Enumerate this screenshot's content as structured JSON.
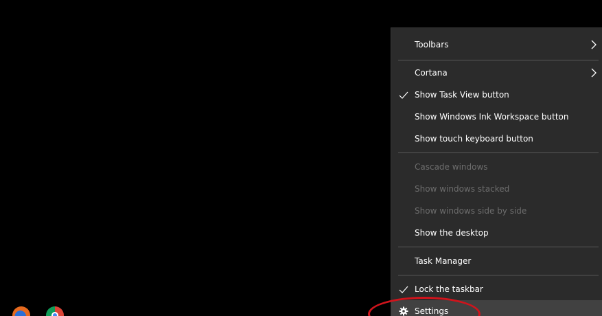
{
  "menu": {
    "items": [
      {
        "label": "Toolbars"
      },
      {
        "label": "Cortana"
      },
      {
        "label": "Show Task View button"
      },
      {
        "label": "Show Windows Ink Workspace button"
      },
      {
        "label": "Show touch keyboard button"
      },
      {
        "label": "Cascade windows"
      },
      {
        "label": "Show windows stacked"
      },
      {
        "label": "Show windows side by side"
      },
      {
        "label": "Show the desktop"
      },
      {
        "label": "Task Manager"
      },
      {
        "label": "Lock the taskbar"
      },
      {
        "label": "Settings"
      }
    ]
  },
  "taskbar": {
    "icons": [
      "firefox-icon",
      "chrome-icon"
    ]
  },
  "colors": {
    "menu_bg": "#2b2b2b",
    "disabled_text": "#6d6d6d",
    "highlight": "#d0141c"
  }
}
